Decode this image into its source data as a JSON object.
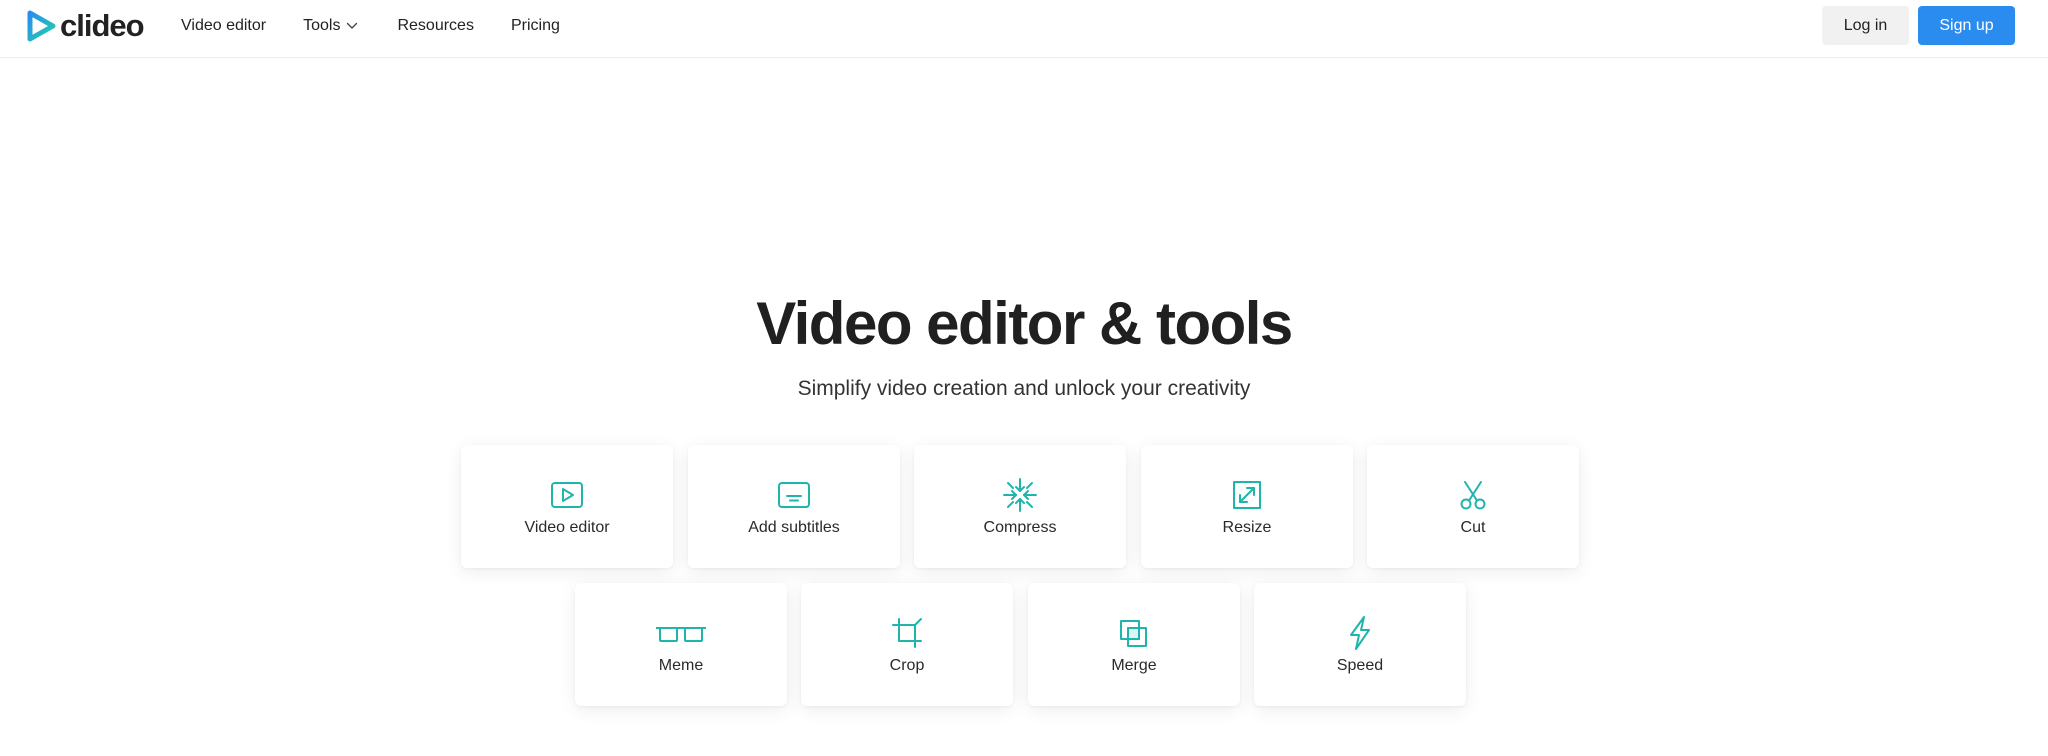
{
  "brand": {
    "name": "clideo",
    "accent": "#1fb5ac",
    "primary_button": "#2b8cf0"
  },
  "nav": {
    "items": [
      {
        "label": "Video editor"
      },
      {
        "label": "Tools",
        "has_dropdown": true
      },
      {
        "label": "Resources"
      },
      {
        "label": "Pricing"
      }
    ]
  },
  "auth": {
    "login_label": "Log in",
    "signup_label": "Sign up"
  },
  "hero": {
    "title": "Video editor & tools",
    "subtitle": "Simplify video creation and unlock your creativity"
  },
  "tools": [
    {
      "label": "Video editor",
      "icon": "play-screen-icon"
    },
    {
      "label": "Add subtitles",
      "icon": "subtitles-icon"
    },
    {
      "label": "Compress",
      "icon": "compress-icon"
    },
    {
      "label": "Resize",
      "icon": "resize-icon"
    },
    {
      "label": "Cut",
      "icon": "scissors-icon"
    },
    {
      "label": "Meme",
      "icon": "meme-glasses-icon"
    },
    {
      "label": "Crop",
      "icon": "crop-icon"
    },
    {
      "label": "Merge",
      "icon": "merge-icon"
    },
    {
      "label": "Speed",
      "icon": "lightning-icon"
    }
  ]
}
